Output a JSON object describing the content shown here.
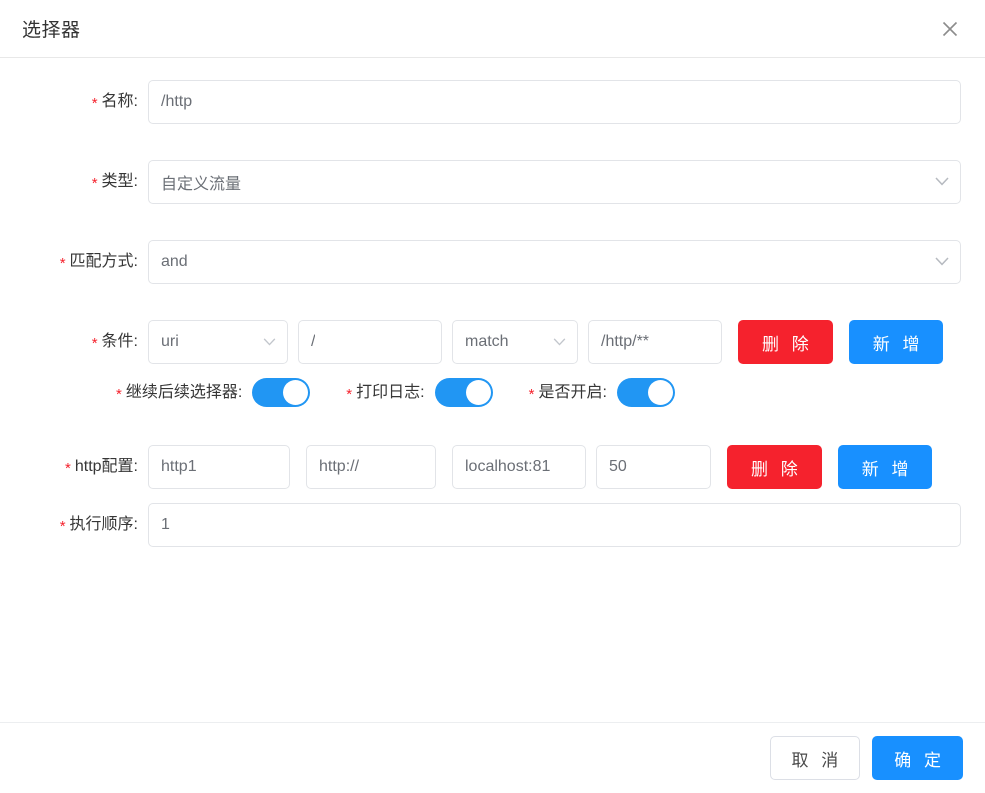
{
  "dialog": {
    "title": "选择器",
    "close_icon": "close-icon"
  },
  "form": {
    "name": {
      "label": "名称:",
      "required": "*",
      "value": "/http"
    },
    "type": {
      "label": "类型:",
      "required": "*",
      "value": "自定义流量",
      "chevron_icon": "chevron-down-icon"
    },
    "match_mode": {
      "label": "匹配方式:",
      "required": "*",
      "value": "and",
      "chevron_icon": "chevron-down-icon"
    },
    "condition": {
      "label": "条件:",
      "required": "*",
      "field": "uri",
      "field_value": "/",
      "operator": "match",
      "operand": "/http/**",
      "delete_label": "删 除",
      "add_label": "新 增"
    },
    "switches": [
      {
        "label": "继续后续选择器:",
        "required": "*",
        "value": "on"
      },
      {
        "label": "打印日志:",
        "required": "*",
        "value": "on"
      },
      {
        "label": "是否开启:",
        "required": "*",
        "value": "on"
      }
    ],
    "http_config": {
      "label": "http配置:",
      "required": "*",
      "name_value": "http1",
      "protocol_value": "http://",
      "host_value": "localhost:81",
      "weight_value": "50",
      "delete_label": "删 除",
      "add_label": "新 增"
    },
    "order": {
      "label": "执行顺序:",
      "required": "*",
      "value": "1"
    }
  },
  "footer": {
    "cancel_label": "取 消",
    "confirm_label": "确 定"
  },
  "colors": {
    "primary": "#1890ff",
    "danger": "#f5222d",
    "switch_on": "#2196f3",
    "required": "#f5222d"
  }
}
